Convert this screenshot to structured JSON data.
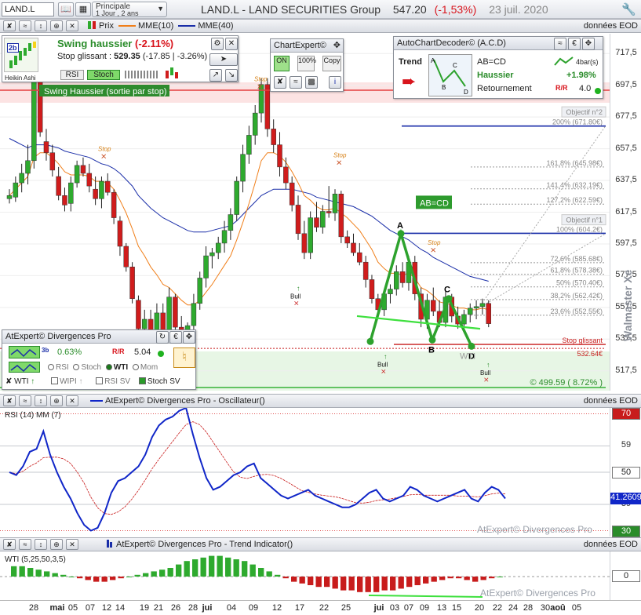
{
  "toolbar": {
    "symbol": "LAND.L",
    "period_main": "Principale",
    "period_sub": "1 Jour , 2 ans",
    "title": "LAND.L - LAND SECURITIES Group",
    "price": "547.20",
    "change": "(-1,53%)",
    "date": "23 juil. 2020"
  },
  "price_panel": {
    "legend_price": "Prix",
    "legend_mme10": "MME(10)",
    "legend_mme40": "MME(40)",
    "eod": "données EOD",
    "scale_ticks": [
      "717,5",
      "697,5",
      "677,5",
      "657,5",
      "637,5",
      "617,5",
      "597,5",
      "577,5",
      "557,5",
      "537,5",
      "517,5"
    ],
    "vertical_label": "Walmaster Xe",
    "objective_2": "Objectif n°2",
    "objective_1": "Objectif n°1",
    "fib_levels": [
      "200% (671.80€)",
      "161,8% (645.98€)",
      "141,4% (632.19€)",
      "127,2% (622.59€)",
      "100% (604.2€)",
      "72,6% (585.68€)",
      "61,8% (578.38€)",
      "50% (570.40€)",
      "38,2% (562.42€)",
      "23,6% (552.55€)"
    ],
    "stop_glissant_label": "Stop glissant",
    "stop_glissant_value": "532.64€",
    "support_label": "© 499.59 ( 8.72% )",
    "banner": "Swing Haussier (sortie par stop)",
    "pattern_label": "AB=CD",
    "pattern_points": [
      "A",
      "B",
      "C",
      "D"
    ],
    "wti_label": "WTI",
    "stop_marker": "Stop",
    "bull_marker": "Bull"
  },
  "swing_widget": {
    "title": "Swing haussier",
    "title_change": "(-2.11%)",
    "stop_prefix": "Stop glissant : ",
    "stop_value": "529.35",
    "stop_change": "(-17.85 | -3.26%)",
    "badge": "2b",
    "heikin": "Heikin Ashi",
    "btn_rsi": "RSI",
    "btn_stoch": "Stoch"
  },
  "chartexpert": {
    "title": "ChartExpert©",
    "btn_on": "ON",
    "btn_100": "100%",
    "btn_copy": "Copy"
  },
  "acd": {
    "title": "AutoChartDecoder© (A.C.D)",
    "trend": "Trend",
    "pattern": "AB=CD",
    "direction": "Haussier",
    "state": "Retournement",
    "bars": "4bar(s)",
    "pct": "+1.98%",
    "score": "4.0",
    "points": [
      "A",
      "B",
      "C",
      "D"
    ]
  },
  "divergence_widget": {
    "title": "AtExpert© Divergences Pro",
    "pct": "0.63%",
    "badge": "3b",
    "ratio": "5.04",
    "r_rsi": "RSI",
    "r_stoch": "Stoch",
    "r_wti": "WTI",
    "r_mom": "Mom",
    "c_wti": "WTI",
    "c_wipi": "WIPI",
    "c_rsisv": "RSI SV",
    "c_stochsv": "Stoch SV"
  },
  "rsi_panel": {
    "caption": "AtExpert© Divergences Pro - Oscillateur()",
    "eod": "données EOD",
    "label": "RSI (14) MM (7)",
    "ticks": [
      "70",
      "59",
      "50",
      "39",
      "30"
    ],
    "current": "41.2609",
    "watermark": "AtExpert© Divergences Pro"
  },
  "trend_panel": {
    "caption": "AtExpert© Divergences Pro - Trend Indicator()",
    "eod": "données EOD",
    "label": "WTI (5,25,50,3,5)",
    "tick_zero": "0",
    "watermark": "AtExpert© Divergences Pro"
  },
  "x_axis": {
    "labels": [
      "28",
      "mai",
      "05",
      "07",
      "12",
      "14",
      "19",
      "21",
      "26",
      "28",
      "jui",
      "04",
      "09",
      "12",
      "17",
      "22",
      "25",
      "jui",
      "03",
      "07",
      "09",
      "13",
      "15",
      "20",
      "22",
      "24",
      "28",
      "30",
      "aoû",
      "05"
    ]
  },
  "colors": {
    "up": "#2eaa2e",
    "down": "#d01c1c",
    "mme10": "#f07f1a",
    "mme40": "#1a2ea8",
    "rsi": "#1026c8",
    "pattern": "#2da22d",
    "accent_red": "#d8141c"
  },
  "chart_data": {
    "type": "candlestick",
    "ylim": [
      505,
      730
    ],
    "candles": [
      [
        626,
        632,
        623,
        628
      ],
      [
        627,
        640,
        624,
        636
      ],
      [
        636,
        648,
        630,
        642
      ],
      [
        642,
        660,
        635,
        650
      ],
      [
        650,
        705,
        645,
        700
      ],
      [
        700,
        705,
        665,
        668
      ],
      [
        662,
        670,
        650,
        655
      ],
      [
        655,
        660,
        640,
        644
      ],
      [
        640,
        646,
        625,
        628
      ],
      [
        628,
        633,
        618,
        622
      ],
      [
        623,
        640,
        618,
        636
      ],
      [
        636,
        650,
        633,
        647
      ],
      [
        647,
        652,
        640,
        642
      ],
      [
        642,
        648,
        630,
        634
      ],
      [
        632,
        640,
        622,
        626
      ],
      [
        626,
        640,
        620,
        637
      ],
      [
        637,
        642,
        628,
        630
      ],
      [
        630,
        632,
        610,
        614
      ],
      [
        612,
        615,
        590,
        596
      ],
      [
        596,
        598,
        580,
        583
      ],
      [
        583,
        586,
        560,
        563
      ],
      [
        562,
        565,
        540,
        544
      ],
      [
        544,
        556,
        530,
        550
      ],
      [
        550,
        556,
        528,
        533
      ],
      [
        533,
        560,
        528,
        554
      ],
      [
        554,
        560,
        535,
        540
      ],
      [
        540,
        570,
        535,
        564
      ],
      [
        564,
        566,
        540,
        545
      ],
      [
        545,
        552,
        533,
        536
      ],
      [
        536,
        548,
        533,
        546
      ],
      [
        546,
        566,
        540,
        560
      ],
      [
        560,
        580,
        556,
        576
      ],
      [
        576,
        596,
        570,
        590
      ],
      [
        590,
        595,
        582,
        592
      ],
      [
        592,
        602,
        588,
        598
      ],
      [
        598,
        612,
        592,
        606
      ],
      [
        606,
        620,
        600,
        616
      ],
      [
        616,
        640,
        612,
        637
      ],
      [
        637,
        660,
        630,
        654
      ],
      [
        654,
        672,
        648,
        666
      ],
      [
        666,
        685,
        660,
        680
      ],
      [
        680,
        702,
        674,
        698
      ],
      [
        698,
        702,
        665,
        670
      ],
      [
        670,
        676,
        655,
        660
      ],
      [
        660,
        668,
        640,
        646
      ],
      [
        646,
        652,
        632,
        636
      ],
      [
        636,
        640,
        618,
        622
      ],
      [
        622,
        628,
        600,
        604
      ],
      [
        604,
        612,
        588,
        592
      ],
      [
        592,
        618,
        588,
        614
      ],
      [
        614,
        624,
        605,
        608
      ],
      [
        608,
        622,
        604,
        618
      ],
      [
        618,
        634,
        614,
        617
      ],
      [
        617,
        632,
        612,
        629
      ],
      [
        629,
        631,
        598,
        602
      ],
      [
        602,
        606,
        595,
        598
      ],
      [
        598,
        604,
        590,
        592
      ],
      [
        592,
        598,
        584,
        586
      ],
      [
        586,
        590,
        570,
        575
      ],
      [
        575,
        578,
        560,
        563
      ],
      [
        563,
        566,
        553,
        556
      ],
      [
        556,
        568,
        552,
        566
      ],
      [
        566,
        572,
        560,
        569
      ],
      [
        569,
        584,
        565,
        580
      ],
      [
        580,
        586,
        570,
        573
      ],
      [
        573,
        590,
        568,
        586
      ],
      [
        586,
        590,
        562,
        566
      ],
      [
        566,
        570,
        545,
        550
      ],
      [
        550,
        566,
        544,
        562
      ],
      [
        562,
        570,
        552,
        555
      ],
      [
        555,
        562,
        545,
        548
      ],
      [
        548,
        568,
        545,
        564
      ],
      [
        564,
        566,
        548,
        552
      ],
      [
        552,
        558,
        544,
        547
      ],
      [
        547,
        556,
        545,
        553
      ],
      [
        553,
        560,
        548,
        557
      ],
      [
        557,
        562,
        550,
        558
      ],
      [
        558,
        563,
        553,
        560
      ],
      [
        560,
        562,
        545,
        547.2
      ]
    ],
    "mme10": [
      628,
      632,
      636,
      640,
      652,
      655,
      655,
      652,
      648,
      643,
      641,
      641,
      641,
      640,
      637,
      637,
      636,
      632,
      625,
      617,
      607,
      596,
      590,
      583,
      578,
      572,
      570,
      566,
      562,
      559,
      559,
      562,
      567,
      572,
      578,
      584,
      590,
      600,
      611,
      623,
      636,
      650,
      655,
      655,
      653,
      649,
      643,
      636,
      628,
      625,
      621,
      619,
      619,
      620,
      617,
      614,
      610,
      606,
      600,
      594,
      586,
      582,
      579,
      579,
      578,
      579,
      576,
      570,
      568,
      565,
      561,
      560,
      559,
      557,
      557,
      556,
      556,
      557,
      556
    ],
    "mme40": [
      664,
      662,
      660,
      658,
      660,
      660,
      660,
      659,
      658,
      656,
      655,
      654,
      653,
      652,
      650,
      648,
      647,
      645,
      642,
      638,
      634,
      628,
      624,
      620,
      617,
      614,
      612,
      610,
      608,
      606,
      605,
      605,
      605,
      606,
      607,
      608,
      609,
      612,
      616,
      620,
      624,
      628,
      630,
      632,
      632,
      632,
      632,
      631,
      630,
      629,
      627,
      626,
      625,
      624,
      623,
      622,
      621,
      619,
      617,
      615,
      612,
      609,
      606,
      604,
      602,
      600,
      597,
      594,
      592,
      589,
      587,
      585,
      583,
      581,
      579,
      577,
      576,
      575,
      574
    ],
    "rsi": [
      50,
      49,
      52,
      57,
      58,
      64,
      56,
      50,
      45,
      41,
      36,
      32,
      30,
      31,
      36,
      43,
      47,
      48,
      50,
      52,
      56,
      62,
      66,
      68,
      69,
      71,
      72,
      63,
      55,
      48,
      44,
      45,
      47,
      49,
      50,
      52,
      53,
      48,
      46,
      44,
      42,
      41,
      42,
      43,
      44,
      42,
      41,
      40,
      39,
      38,
      38,
      39,
      41,
      43,
      44,
      41,
      40,
      41,
      42,
      45,
      44,
      42,
      41,
      40,
      41,
      42,
      43,
      44,
      41,
      40,
      43,
      45,
      44,
      41
    ],
    "wti": [
      6,
      6,
      5,
      4,
      3,
      2,
      1,
      0,
      -1,
      -2,
      -3,
      -3,
      -2,
      -1,
      0,
      1,
      2,
      3,
      4,
      5,
      7,
      9,
      10,
      11,
      12,
      12,
      11,
      10,
      9,
      7,
      5,
      3,
      1,
      -1,
      -3,
      -4,
      -5,
      -6,
      -6,
      -7,
      -8,
      -8,
      -9,
      -9,
      -9,
      -8,
      -8,
      -7,
      -6,
      -5,
      -4,
      -3,
      -2,
      -1,
      -1,
      -2,
      -3,
      -2,
      -1,
      0
    ]
  }
}
